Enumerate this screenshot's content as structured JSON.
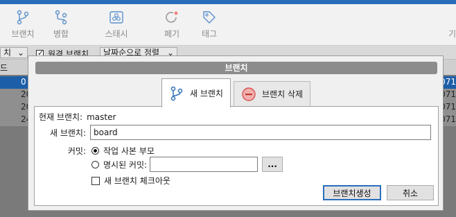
{
  "toolbar": {
    "buttons": [
      {
        "label": "브랜치",
        "icon": "branch-icon"
      },
      {
        "label": "병합",
        "icon": "merge-icon"
      },
      {
        "label": "스태시",
        "icon": "stash-icon"
      },
      {
        "label": "폐기",
        "icon": "discard-icon"
      },
      {
        "label": "태그",
        "icon": "tag-icon"
      }
    ],
    "right_cut_text": "기"
  },
  "filter_bar": {
    "branch_filter_text": "치",
    "remote_branch_label": "원격 브랜치",
    "sort_label": "날짜순으로 정렬"
  },
  "list": {
    "header_stub": "드",
    "rows": [
      {
        "left": "0",
        "right": "071",
        "selected": true
      },
      {
        "left": "20",
        "right": "071",
        "selected": false
      },
      {
        "left": "20",
        "right": "071",
        "selected": false
      },
      {
        "left": "24",
        "right": "071",
        "selected": false
      }
    ]
  },
  "dialog": {
    "title": "브랜치",
    "tabs": {
      "new_branch": "새 브랜치",
      "delete_branch": "브랜치 삭제"
    },
    "current_branch_label": "현재 브랜치:",
    "current_branch_value": "master",
    "new_branch_label": "새 브랜치:",
    "new_branch_value": "board",
    "commit_label": "커밋:",
    "radio_working_copy": "작업 사본 부모",
    "radio_specified_commit": "명시된 커밋:",
    "specified_commit_value": "",
    "ellipsis_button": "...",
    "checkout_checkbox": "새 브랜치 체크아웃",
    "create_button": "브랜치생성",
    "cancel_button": "취소"
  },
  "colors": {
    "accent": "#2a6ebb",
    "delete_icon": "#e36b6b",
    "branch_icon": "#2f6fb3"
  }
}
